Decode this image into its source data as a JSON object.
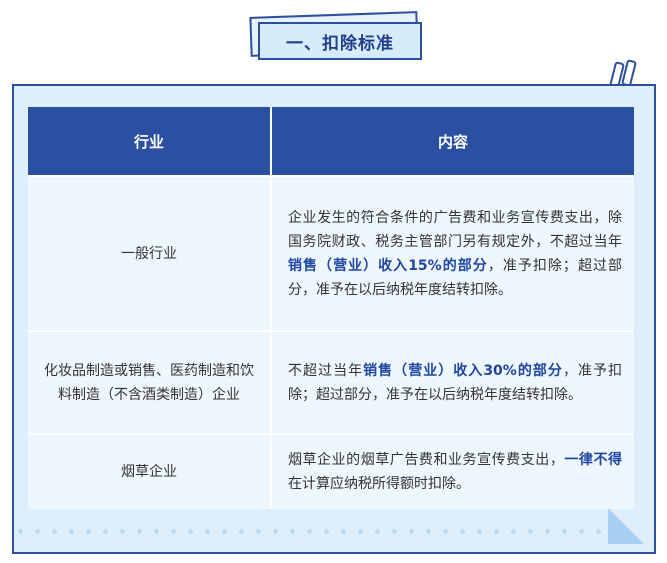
{
  "title": "一、扣除标准",
  "table": {
    "headers": [
      "行业",
      "内容"
    ],
    "rows": [
      {
        "category": "一般行业",
        "content": [
          {
            "text": "企业发生的符合条件的广告费和业务宣传费支出，除国务院财政、税务主管部门另有规定外，不超过当年",
            "bold": false
          },
          {
            "text": "销售（营业）收入15%的部分",
            "bold": true
          },
          {
            "text": "，准予扣除；超过部分，准予在以后纳税年度结转扣除。",
            "bold": false
          }
        ]
      },
      {
        "category": "化妆品制造或销售、医药制造和饮料制造（不含酒类制造）企业",
        "content": [
          {
            "text": "不超过当年",
            "bold": false
          },
          {
            "text": "销售（营业）收入30%的部分",
            "bold": true
          },
          {
            "text": "，准予扣除；超过部分，准予在以后纳税年度结转扣除。",
            "bold": false
          }
        ]
      },
      {
        "category": "烟草企业",
        "content": [
          {
            "text": "烟草企业的烟草广告费和业务宣传费支出，",
            "bold": false
          },
          {
            "text": "一律不得",
            "bold": true
          },
          {
            "text": "在计算应纳税所得额时扣除。",
            "bold": false
          }
        ]
      }
    ]
  },
  "colors": {
    "header_bg": "#2b50a1",
    "cell_bg": "#eef7fe",
    "frame_bg": "#deeefb",
    "highlight": "#1f46a0"
  }
}
